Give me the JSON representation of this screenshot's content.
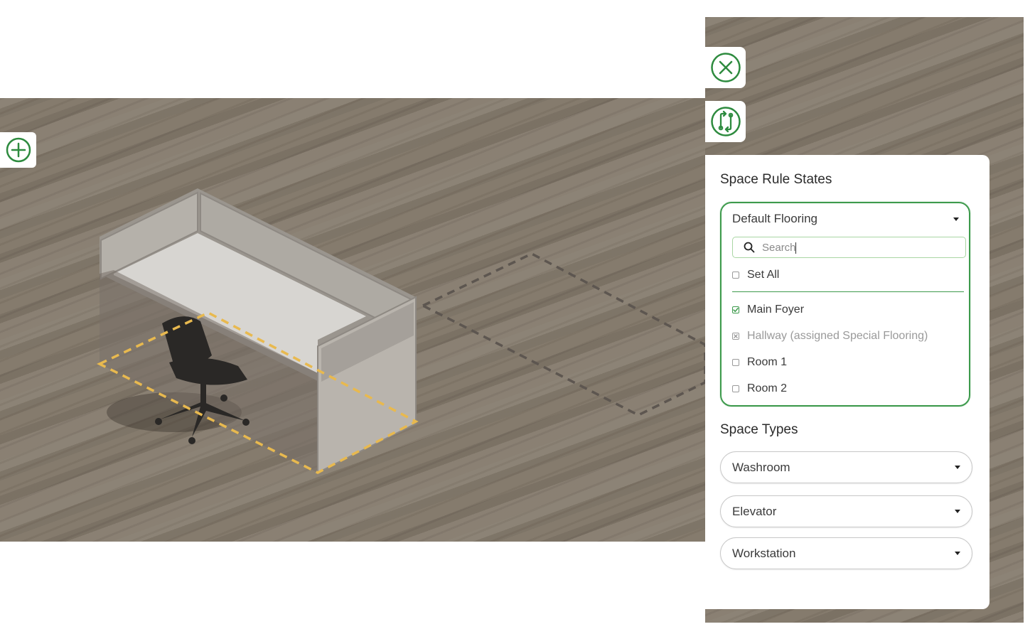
{
  "toolbar": {
    "add_icon": "plus-circle-icon",
    "close_icon": "close-circle-icon",
    "swap_icon": "swap-circle-icon",
    "accent_color": "#2e8b3f"
  },
  "panel": {
    "rule_states_title": "Space Rule States",
    "flooring_dropdown": {
      "selected": "Default Flooring",
      "search_placeholder": "Search",
      "set_all_label": "Set All",
      "options": [
        {
          "label": "Main Foyer",
          "state": "checked"
        },
        {
          "label": "Hallway (assigned Special Flooring)",
          "state": "disabled"
        },
        {
          "label": "Room 1",
          "state": "unchecked"
        },
        {
          "label": "Room 2",
          "state": "unchecked"
        }
      ]
    },
    "space_types_title": "Space Types",
    "space_types": [
      {
        "label": "Washroom"
      },
      {
        "label": "Elevator"
      },
      {
        "label": "Workstation"
      }
    ]
  }
}
